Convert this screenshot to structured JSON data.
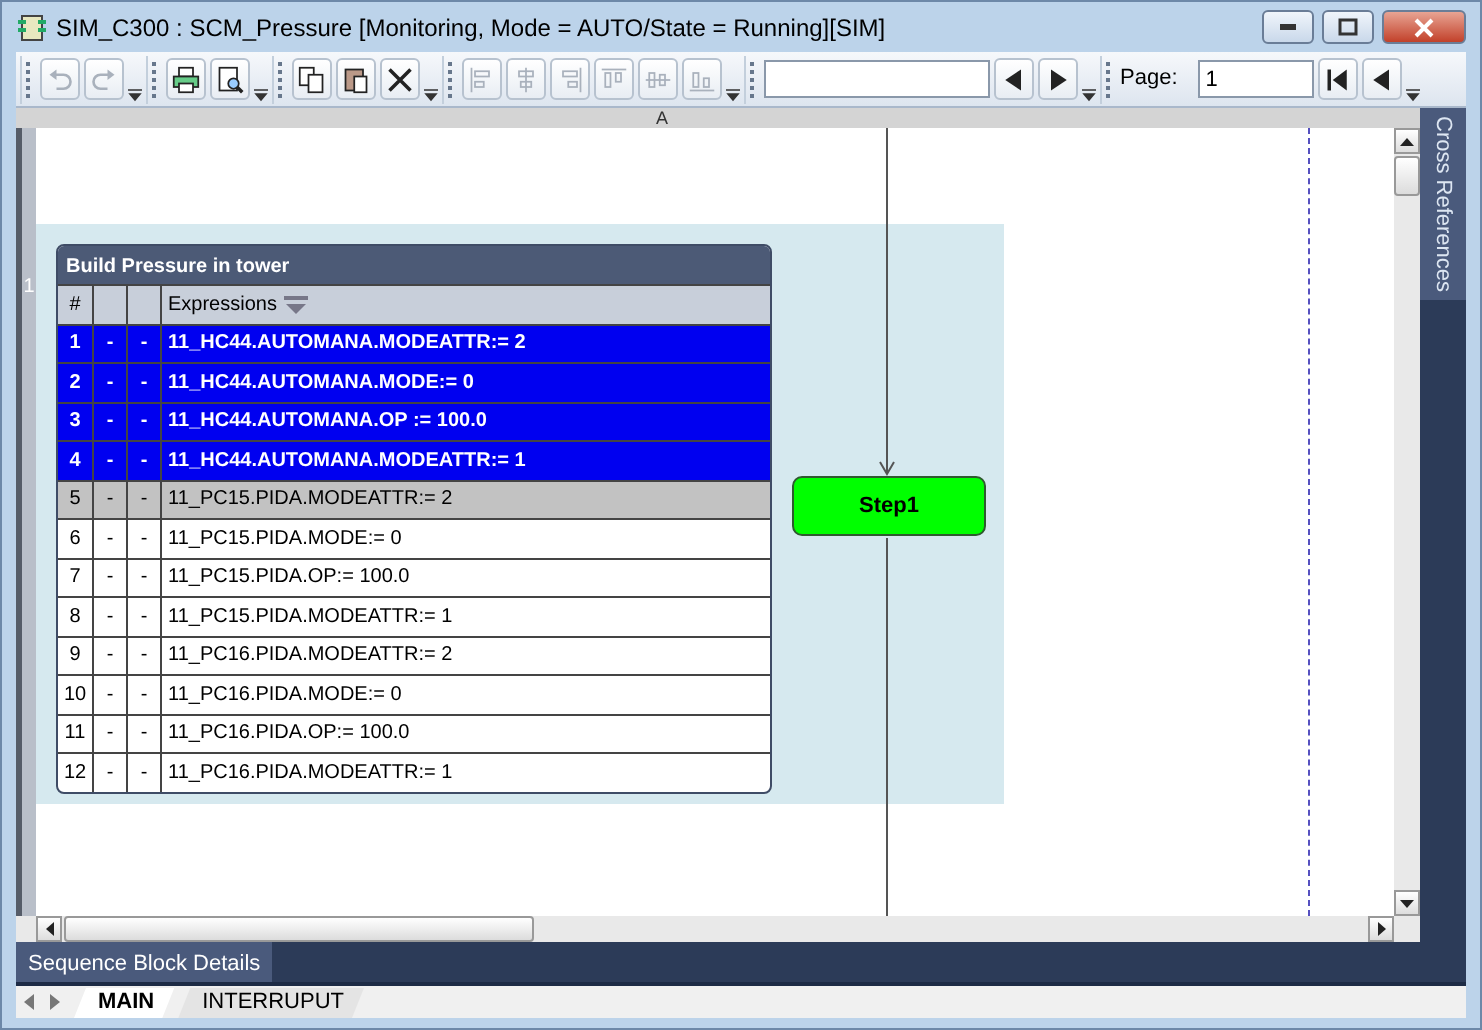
{
  "window": {
    "title": "SIM_C300 : SCM_Pressure [Monitoring, Mode  = AUTO/State = Running][SIM]"
  },
  "toolbar": {
    "groups": [
      {
        "tools": [
          {
            "kind": "undo",
            "disabled": true
          },
          {
            "kind": "redo",
            "disabled": true
          }
        ]
      },
      {
        "tools": [
          {
            "kind": "print",
            "disabled": false
          },
          {
            "kind": "preview",
            "disabled": false
          }
        ]
      },
      {
        "tools": [
          {
            "kind": "copy",
            "disabled": false
          },
          {
            "kind": "paste",
            "disabled": false
          },
          {
            "kind": "delete",
            "disabled": false
          }
        ]
      },
      {
        "tools": [
          {
            "kind": "align-left",
            "disabled": true
          },
          {
            "kind": "align-center",
            "disabled": true
          },
          {
            "kind": "align-right",
            "disabled": true
          },
          {
            "kind": "align-top",
            "disabled": true
          },
          {
            "kind": "align-middle",
            "disabled": true
          },
          {
            "kind": "align-bottom",
            "disabled": true
          }
        ]
      }
    ],
    "search_nav": [
      {
        "kind": "prev",
        "disabled": false
      },
      {
        "kind": "next",
        "disabled": false
      }
    ],
    "page_label": "Page:",
    "page_value": "1",
    "page_nav": [
      {
        "kind": "first",
        "disabled": false
      },
      {
        "kind": "prev",
        "disabled": false
      }
    ]
  },
  "ruler": {
    "column_label": "A"
  },
  "canvas": {
    "row_label": "1",
    "block": {
      "title": "Build Pressure in tower",
      "number_heading": "#",
      "expression_heading": "Expressions",
      "rows": [
        {
          "number": "1",
          "column_2": "-",
          "column_3": "-",
          "expression": "11_HC44.AUTOMANA.MODEATTR:= 2",
          "selected": true,
          "current": false
        },
        {
          "number": "2",
          "column_2": "-",
          "column_3": "-",
          "expression": "11_HC44.AUTOMANA.MODE:= 0",
          "selected": true,
          "current": false
        },
        {
          "number": "3",
          "column_2": "-",
          "column_3": "-",
          "expression": "11_HC44.AUTOMANA.OP := 100.0",
          "selected": true,
          "current": false
        },
        {
          "number": "4",
          "column_2": "-",
          "column_3": "-",
          "expression": "11_HC44.AUTOMANA.MODEATTR:= 1",
          "selected": true,
          "current": false
        },
        {
          "number": "5",
          "column_2": "-",
          "column_3": "-",
          "expression": "11_PC15.PIDA.MODEATTR:= 2",
          "selected": false,
          "current": true
        },
        {
          "number": "6",
          "column_2": "-",
          "column_3": "-",
          "expression": "11_PC15.PIDA.MODE:= 0",
          "selected": false,
          "current": false
        },
        {
          "number": "7",
          "column_2": "-",
          "column_3": "-",
          "expression": "11_PC15.PIDA.OP:= 100.0",
          "selected": false,
          "current": false
        },
        {
          "number": "8",
          "column_2": "-",
          "column_3": "-",
          "expression": "11_PC15.PIDA.MODEATTR:= 1",
          "selected": false,
          "current": false
        },
        {
          "number": "9",
          "column_2": "-",
          "column_3": "-",
          "expression": "11_PC16.PIDA.MODEATTR:= 2",
          "selected": false,
          "current": false
        },
        {
          "number": "10",
          "column_2": "-",
          "column_3": "-",
          "expression": "11_PC16.PIDA.MODE:= 0",
          "selected": false,
          "current": false
        },
        {
          "number": "11",
          "column_2": "-",
          "column_3": "-",
          "expression": "11_PC16.PIDA.OP:= 100.0",
          "selected": false,
          "current": false
        },
        {
          "number": "12",
          "column_2": "-",
          "column_3": "-",
          "expression": "11_PC16.PIDA.MODEATTR:= 1",
          "selected": false,
          "current": false
        }
      ]
    },
    "step": {
      "label": "Step1",
      "active": true
    }
  },
  "side_panel": {
    "title": "Cross References"
  },
  "details_bar": {
    "title": "Sequence Block Details"
  },
  "sheet_tabs": [
    {
      "label": "MAIN",
      "selected": true
    },
    {
      "label": "INTERRUPUT",
      "selected": false
    }
  ]
}
